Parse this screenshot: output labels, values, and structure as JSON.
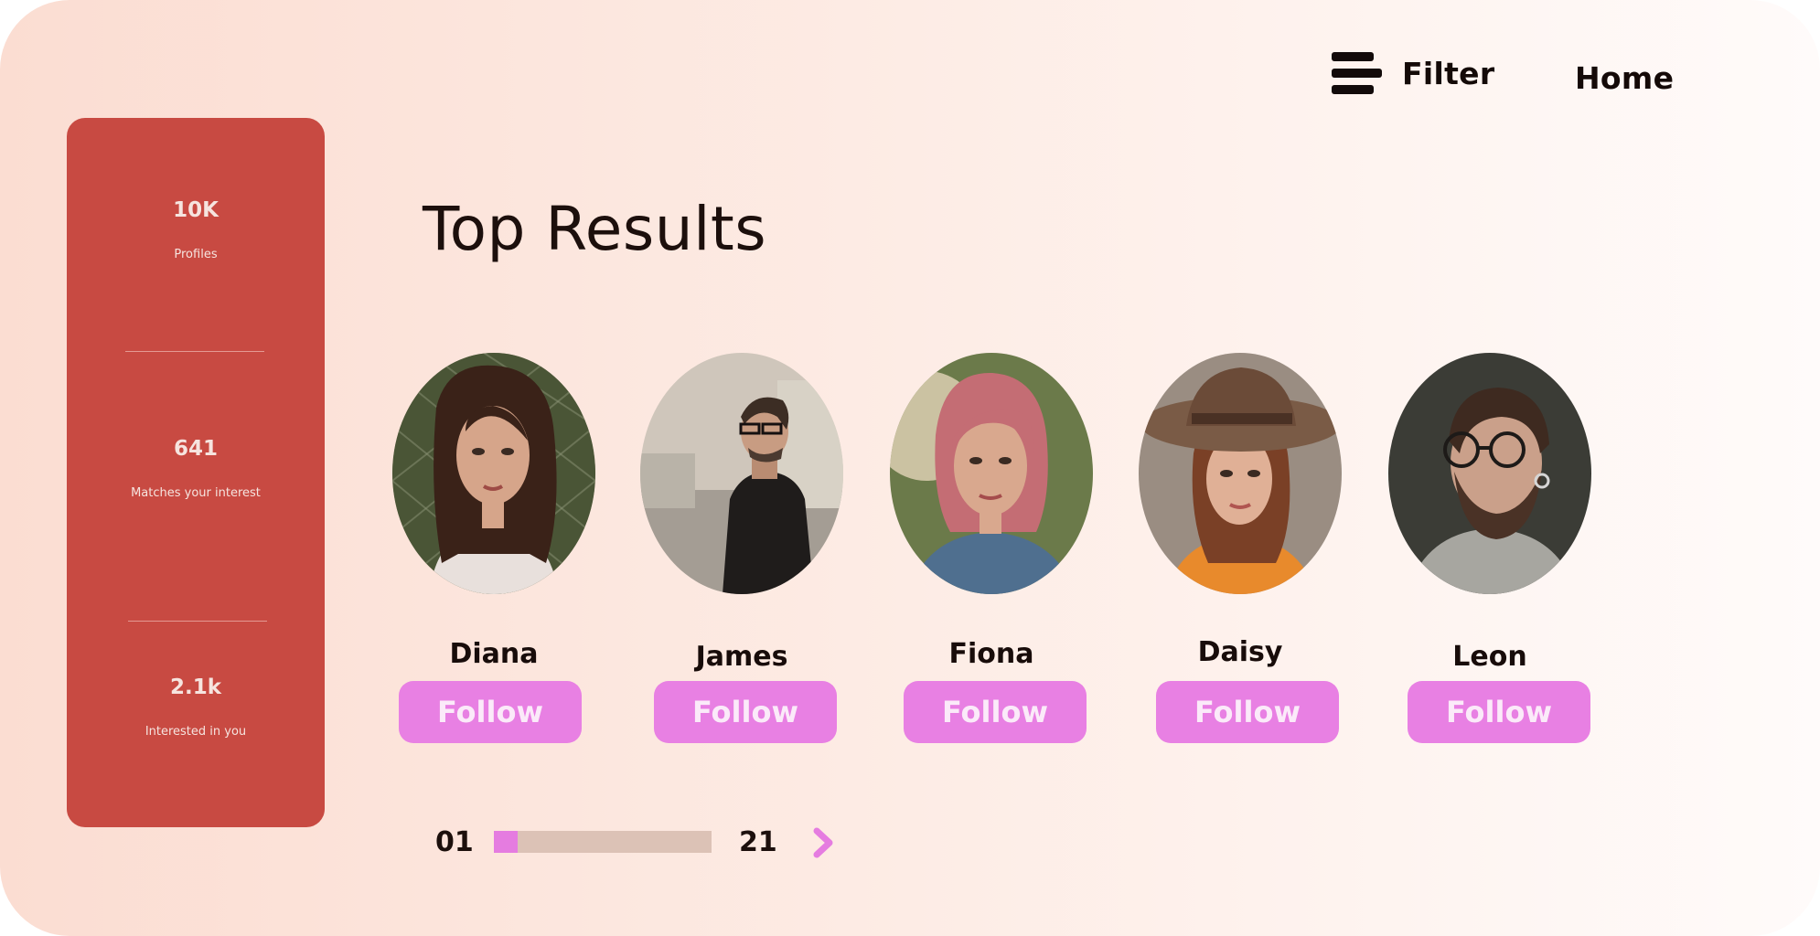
{
  "nav": {
    "filter_label": "Filter",
    "home_label": "Home"
  },
  "stats": [
    {
      "value": "10K",
      "label": "Profiles"
    },
    {
      "value": "641",
      "label": "Matches your interest"
    },
    {
      "value": "2.1k",
      "label": "Interested in you"
    }
  ],
  "title": "Top Results",
  "profiles": [
    {
      "name": "Diana",
      "follow_label": "Follow"
    },
    {
      "name": "James",
      "follow_label": "Follow"
    },
    {
      "name": "Fiona",
      "follow_label": "Follow"
    },
    {
      "name": "Daisy",
      "follow_label": "Follow"
    },
    {
      "name": "Leon",
      "follow_label": "Follow"
    }
  ],
  "pagination": {
    "current": "01",
    "total": "21",
    "progress_fraction": 0.05
  },
  "colors": {
    "sidebar": "#c84a42",
    "follow_button": "#e880e3",
    "progress_fill": "#e57ce0",
    "progress_track": "#dcc2b6"
  },
  "icons": {
    "menu": "menu-icon",
    "next": "chevron-right-icon"
  }
}
